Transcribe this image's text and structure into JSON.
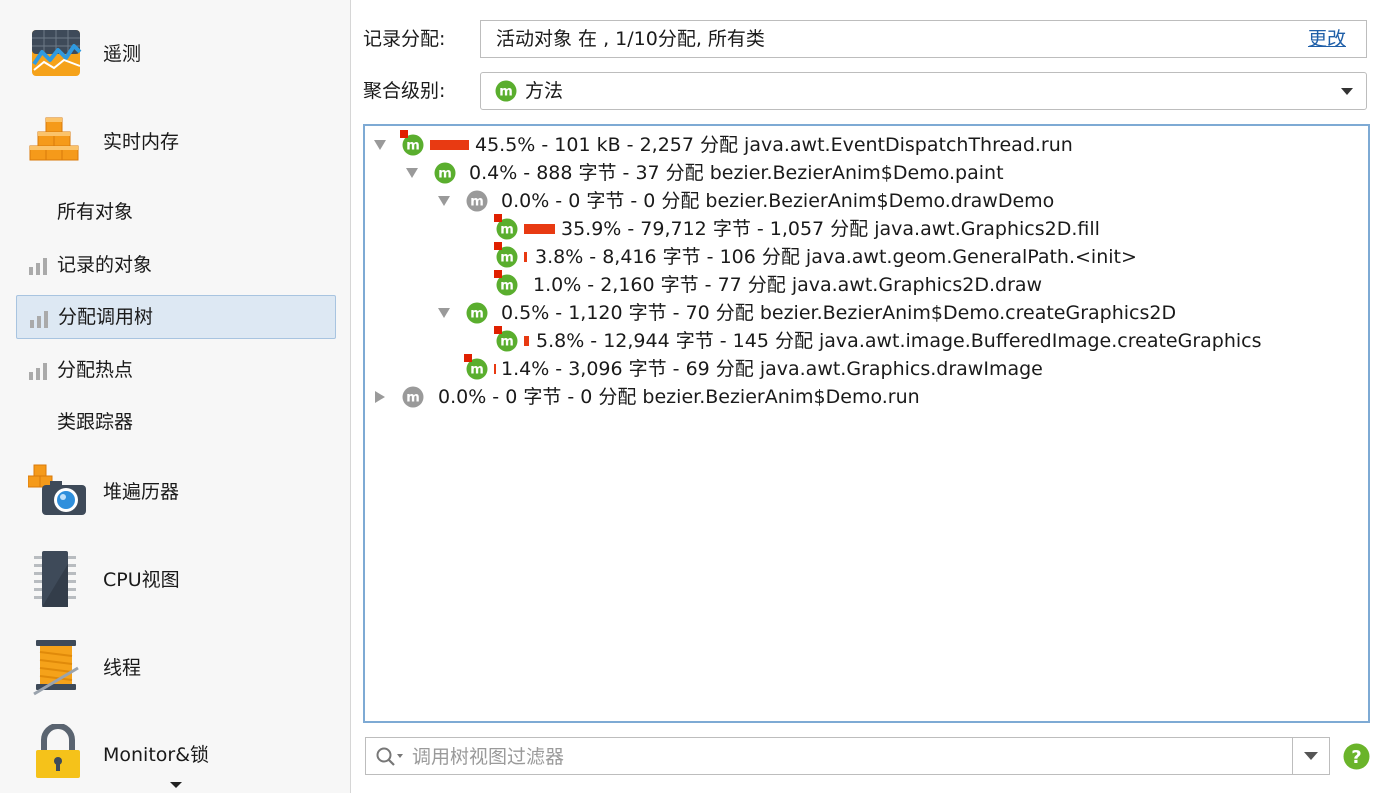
{
  "sidebar": {
    "telemetry": "遥测",
    "live_memory": "实时内存",
    "sub_items": [
      {
        "label": "所有对象"
      },
      {
        "label": "记录的对象"
      },
      {
        "label": "分配调用树"
      },
      {
        "label": "分配热点"
      },
      {
        "label": "类跟踪器"
      }
    ],
    "heap_walker": "堆遍历器",
    "cpu_views": "CPU视图",
    "threads": "线程",
    "monitors": "Monitor&锁"
  },
  "record": {
    "label": "记录分配:",
    "value": "活动对象 在 , 1/10分配, 所有类",
    "change": "更改"
  },
  "aggregation": {
    "label": "聚合级别:",
    "value": "方法",
    "icon": "method-m-icon"
  },
  "tree": {
    "nodes": [
      {
        "text": "45.5% - 101 kB - 2,257 分配 java.awt.EventDispatchThread.run",
        "percent": 45.5,
        "expander": "down",
        "color": "green",
        "flag": true
      },
      {
        "text": "0.4% - 888 字节 - 37 分配 bezier.BezierAnim$Demo.paint",
        "percent": 0.4,
        "expander": "down",
        "color": "green",
        "flag": false
      },
      {
        "text": "0.0% - 0 字节 - 0 分配 bezier.BezierAnim$Demo.drawDemo",
        "percent": 0.0,
        "expander": "down",
        "color": "gray",
        "flag": false
      },
      {
        "text": "35.9% - 79,712 字节 - 1,057 分配 java.awt.Graphics2D.fill",
        "percent": 35.9,
        "expander": "none",
        "color": "green",
        "flag": true
      },
      {
        "text": "3.8% - 8,416 字节 - 106 分配 java.awt.geom.GeneralPath.<init>",
        "percent": 3.8,
        "expander": "none",
        "color": "green",
        "flag": true
      },
      {
        "text": "1.0% - 2,160 字节 - 77 分配 java.awt.Graphics2D.draw",
        "percent": 1.0,
        "expander": "none",
        "color": "green",
        "flag": true
      },
      {
        "text": "0.5% - 1,120 字节 - 70 分配 bezier.BezierAnim$Demo.createGraphics2D",
        "percent": 0.5,
        "expander": "down",
        "color": "green",
        "flag": false
      },
      {
        "text": "5.8% - 12,944 字节 - 145 分配 java.awt.image.BufferedImage.createGraphics",
        "percent": 5.8,
        "expander": "none",
        "color": "green",
        "flag": true
      },
      {
        "text": "1.4% - 3,096 字节 - 69 分配 java.awt.Graphics.drawImage",
        "percent": 1.4,
        "expander": "none",
        "color": "green",
        "flag": true
      },
      {
        "text": "0.0% - 0 字节 - 0 分配 bezier.BezierAnim$Demo.run",
        "percent": 0.0,
        "expander": "right",
        "color": "gray",
        "flag": false
      }
    ]
  },
  "filter": {
    "placeholder": "调用树视图过滤器"
  },
  "colors": {
    "accent_blue": "#7eaad4",
    "selected_bg": "#dde8f3",
    "bar_red": "#e83a12",
    "method_green": "#5aae2e",
    "method_gray": "#9a9a9a",
    "help_green": "#6ab42a"
  }
}
